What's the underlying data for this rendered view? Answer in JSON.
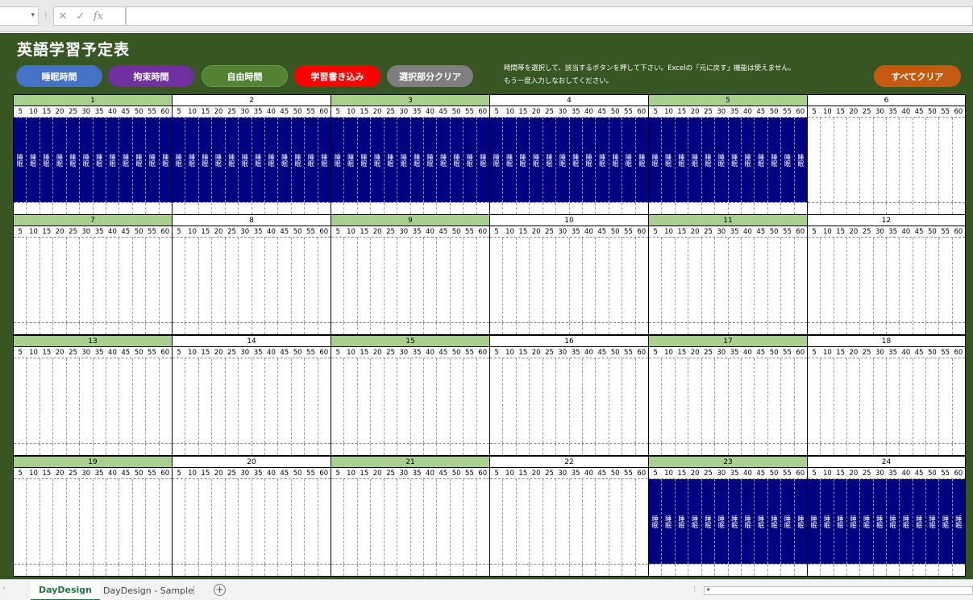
{
  "formula_bar": {
    "caret": "▾",
    "sep": "⁝",
    "cancel": "✕",
    "enter": "✓",
    "fx": "fx",
    "value": ""
  },
  "header": {
    "title": "英語学習予定表",
    "buttons": [
      {
        "label": "睡眠時間",
        "color": "#4472c4"
      },
      {
        "label": "拘束時間",
        "color": "#7030a0"
      },
      {
        "label": "自由時間",
        "color": "#548235"
      },
      {
        "label": "学習書き込み",
        "color": "#ff0000"
      },
      {
        "label": "選択部分クリア",
        "color": "#7f7f7f"
      }
    ],
    "instruction_line1": "時間帯を選択して、該当するボタンを押して下さい。Excelの「元に戻す」機能は使えません。",
    "instruction_line2": "もう一度入力しなおしてください。",
    "clear_all": {
      "label": "すべてクリア",
      "color": "#c55a11"
    }
  },
  "minute_labels": [
    "5",
    "10",
    "15",
    "20",
    "25",
    "30",
    "35",
    "40",
    "45",
    "50",
    "55",
    "60"
  ],
  "sleep_label": "睡眠",
  "hours": [
    {
      "label": "1",
      "sleep_cols": 12
    },
    {
      "label": "2",
      "sleep_cols": 12
    },
    {
      "label": "3",
      "sleep_cols": 12
    },
    {
      "label": "4",
      "sleep_cols": 12
    },
    {
      "label": "5",
      "sleep_cols": 12
    },
    {
      "label": "6",
      "sleep_cols": 0
    },
    {
      "label": "7",
      "sleep_cols": 0
    },
    {
      "label": "8",
      "sleep_cols": 0
    },
    {
      "label": "9",
      "sleep_cols": 0
    },
    {
      "label": "10",
      "sleep_cols": 0
    },
    {
      "label": "11",
      "sleep_cols": 0
    },
    {
      "label": "12",
      "sleep_cols": 0
    },
    {
      "label": "13",
      "sleep_cols": 0
    },
    {
      "label": "14",
      "sleep_cols": 0
    },
    {
      "label": "15",
      "sleep_cols": 0
    },
    {
      "label": "16",
      "sleep_cols": 0
    },
    {
      "label": "17",
      "sleep_cols": 0
    },
    {
      "label": "18",
      "sleep_cols": 0
    },
    {
      "label": "19",
      "sleep_cols": 0
    },
    {
      "label": "20",
      "sleep_cols": 0
    },
    {
      "label": "21",
      "sleep_cols": 0
    },
    {
      "label": "22",
      "sleep_cols": 0
    },
    {
      "label": "23",
      "sleep_cols": 12
    },
    {
      "label": "24",
      "sleep_cols": 12
    }
  ],
  "tabs": {
    "nav": "›",
    "active": "DayDesign",
    "other": "DayDesign - Sample",
    "add": "+"
  },
  "scroll": {
    "arrow": "◂",
    "dots": "⁝"
  },
  "colors": {
    "header_bg": "#375623",
    "hour_green": "#a9d08e",
    "sleep_fill": "#000080"
  }
}
